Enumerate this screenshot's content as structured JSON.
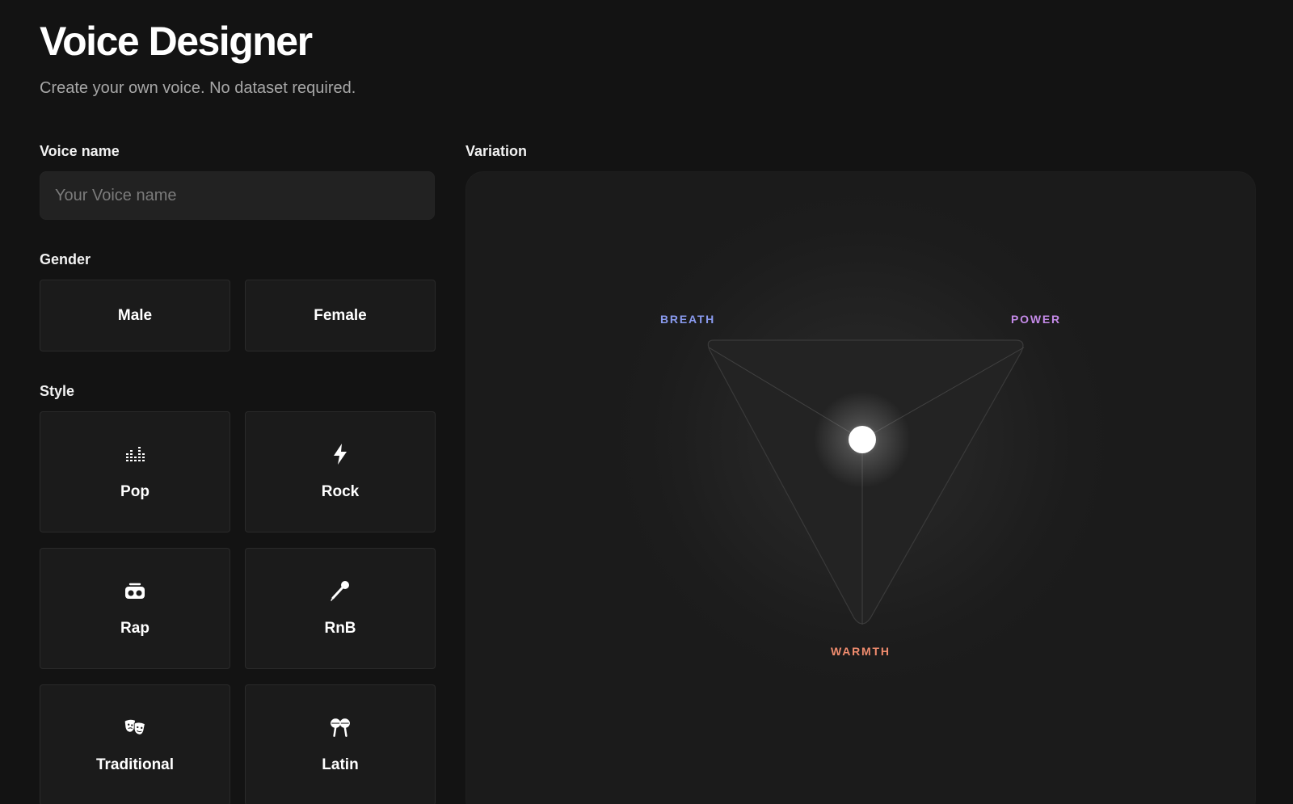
{
  "header": {
    "title": "Voice Designer",
    "subtitle": "Create your own voice. No dataset required."
  },
  "voice_name": {
    "label": "Voice name",
    "placeholder": "Your Voice name",
    "value": ""
  },
  "gender": {
    "label": "Gender",
    "options": [
      {
        "label": "Male"
      },
      {
        "label": "Female"
      }
    ]
  },
  "style": {
    "label": "Style",
    "options": [
      {
        "label": "Pop",
        "icon": "equalizer-icon"
      },
      {
        "label": "Rock",
        "icon": "lightning-bolt-icon"
      },
      {
        "label": "Rap",
        "icon": "boombox-icon"
      },
      {
        "label": "RnB",
        "icon": "microphone-icon"
      },
      {
        "label": "Traditional",
        "icon": "theater-masks-icon"
      },
      {
        "label": "Latin",
        "icon": "maracas-icon"
      }
    ]
  },
  "variation": {
    "label": "Variation",
    "axes": [
      {
        "label": "BREATH",
        "color": "#8a9bf0"
      },
      {
        "label": "POWER",
        "color": "#c48ae8"
      },
      {
        "label": "WARMTH",
        "color": "#f08c6e"
      }
    ]
  },
  "colors": {
    "background": "#131313",
    "card": "#1b1b1b",
    "input": "#222222",
    "text": "#ffffff",
    "muted_text": "#a7a7a7"
  }
}
